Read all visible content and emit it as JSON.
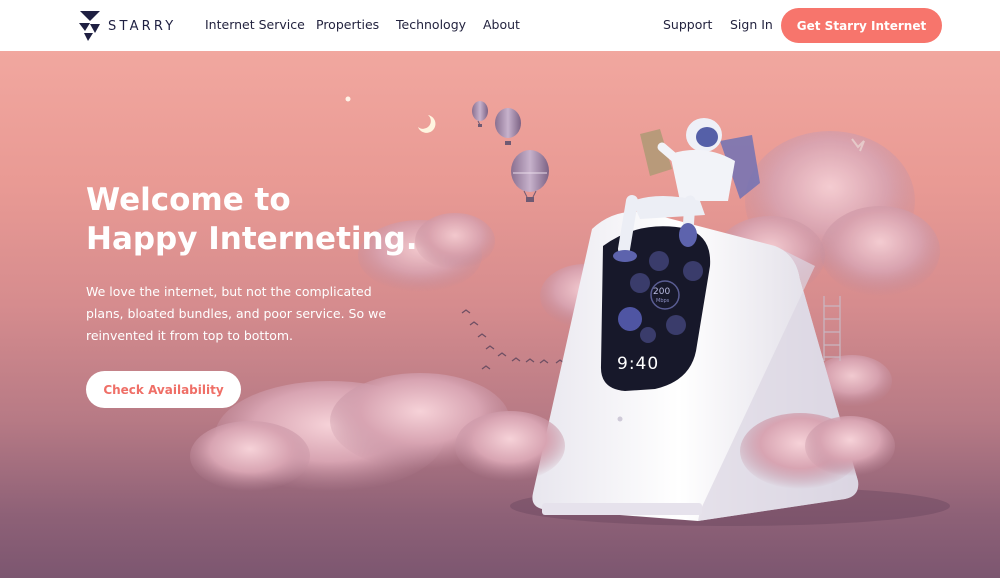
{
  "brand": {
    "name": "STARRY"
  },
  "nav": {
    "items": [
      {
        "label": "Internet Service"
      },
      {
        "label": "Properties"
      },
      {
        "label": "Technology"
      },
      {
        "label": "About"
      }
    ],
    "support_label": "Support",
    "signin_label": "Sign In",
    "cta_label": "Get Starry Internet"
  },
  "hero": {
    "title_line1": "Welcome to",
    "title_line2": "Happy Interneting.",
    "body": "We love the internet, but not the complicated plans, bloated bundles, and poor service. So we reinvented it from top to bottom.",
    "button_label": "Check Availability"
  },
  "device": {
    "time": "9:40",
    "speed": "200",
    "speed_unit": "Mbps"
  },
  "colors": {
    "accent": "#f7756c",
    "nav_text": "#23233f",
    "hero_top": "#f1a79f",
    "hero_bottom": "#7c5670"
  }
}
